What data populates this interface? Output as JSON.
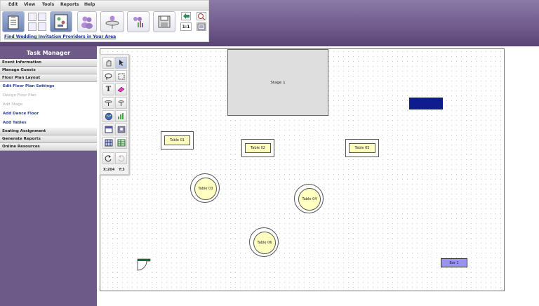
{
  "menubar": {
    "items": [
      "Edit",
      "View",
      "Tools",
      "Reports",
      "Help"
    ]
  },
  "toolbar": {
    "link_text": "Find Wedding Invitation Providers in Your Area",
    "zoom_label": "1:1"
  },
  "task_manager": {
    "title": "Task Manager",
    "sections": [
      {
        "label": "Event Information"
      },
      {
        "label": "Manage Guests"
      },
      {
        "label": "Floor Plan Layout"
      }
    ],
    "floor_plan_items": [
      {
        "label": "Edit Floor Plan Settings",
        "enabled": true
      },
      {
        "label": "Design Floor Plan",
        "enabled": false
      },
      {
        "label": "Add Stage",
        "enabled": false
      },
      {
        "label": "Add Dance Floor",
        "enabled": true
      },
      {
        "label": "Add Tables",
        "enabled": true
      }
    ],
    "sections_after": [
      {
        "label": "Seating Assignment"
      },
      {
        "label": "Generate Reports"
      },
      {
        "label": "Online Resources"
      }
    ]
  },
  "tools": {
    "coord_x": "X:204",
    "coord_y": "Y:3"
  },
  "floor": {
    "stage_label": "Stage 1",
    "tables": {
      "t1": "Table 01",
      "t2": "Table 02",
      "t3": "Table 03",
      "t4": "Table 04",
      "t5": "Table 05",
      "t6": "Table 06"
    },
    "bar_label": "Bar 1"
  },
  "colors": {
    "accent": "#6e5a88",
    "table_fill": "#ffffc0",
    "bar_fill": "#9a93f0",
    "dark_block": "#0f1d8c"
  }
}
